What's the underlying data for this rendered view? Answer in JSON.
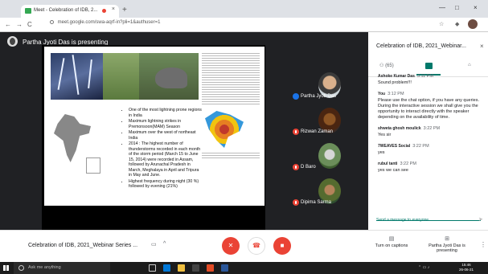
{
  "browser": {
    "tab_title": "Meet - Celebration of IDB, 2...",
    "tab_close": "×",
    "new_tab": "+",
    "url": "meet.google.com/swa-aqrf-in?pli=1&authuser=1",
    "window_controls": [
      "—",
      "□",
      "×"
    ],
    "nav": {
      "back": "←",
      "forward": "→",
      "reload": "C"
    }
  },
  "meet": {
    "presenter_label": "Partha Jyoti Das is presenting"
  },
  "slide": {
    "bullets": [
      "One of the most lightning prone regions in India",
      "Maximum lightning strikes in Premonsoon(MAM) Season",
      "Maximum over the west of northeast India",
      "2014 : The highest number of thunderstorms recorded in each month of the storm period (March 15 to June 15, 2014) were recorded in Assam, followed by Arunachal Pradesh in March, Meghalaya in April and Tripura in May and June.",
      "Highest frequency during night (30 %)  followed by evening (21%)"
    ]
  },
  "participants": [
    {
      "name": "Partha Jyoti Das",
      "status": "speaking"
    },
    {
      "name": "Rizwan Zaman",
      "status": "muted"
    },
    {
      "name": "D Baro",
      "status": "muted"
    },
    {
      "name": "Dipima Sarma",
      "status": "muted"
    }
  ],
  "chat": {
    "title": "Celebration of IDB, 2021_Webinar...",
    "close": "×",
    "people_tab": "(65)",
    "messages": [
      {
        "author": "Ashoke Kumar Das",
        "time": "3:11 PM",
        "text": "Sound problem!!!"
      },
      {
        "author": "You",
        "time": "3:12 PM",
        "text": "Please use the chat option, if you have any queries. During the interactive session we shall give you the opportunity to interact directly with the speaker depending on the availability of time."
      },
      {
        "author": "shweta ghosh moulick",
        "time": "3:22 PM",
        "text": "Yes sir"
      },
      {
        "author": "7WEAVES Social",
        "time": "3:22 PM",
        "text": "yes"
      },
      {
        "author": "rubul tanti",
        "time": "3:22 PM",
        "text": "yes we can see"
      }
    ],
    "input_placeholder": "Send a message to everyone",
    "send": "➤"
  },
  "bottom": {
    "meeting_title": "Celebration of IDB, 2021_Webinar Series ...",
    "captions_label": "Turn on captions",
    "presenting_label": "Partha Jyoti Das is presenting",
    "kebab": "⋮"
  },
  "taskbar": {
    "search_placeholder": "Ask me anything",
    "time": "15:46",
    "date": "26-06-21"
  },
  "colors": {
    "end_call": "#ea4335",
    "accent": "#00796b",
    "speaking": "#1a73e8"
  }
}
